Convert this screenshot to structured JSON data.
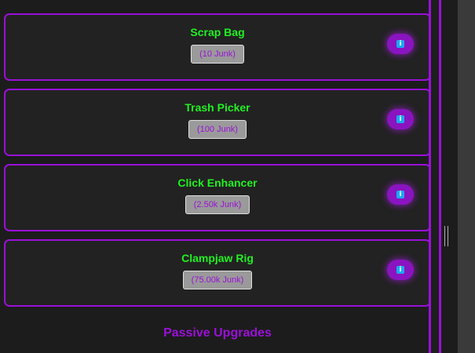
{
  "upgrades": [
    {
      "name": "Scrap Bag",
      "cost": "(10 Junk)"
    },
    {
      "name": "Trash Picker",
      "cost": "(100 Junk)"
    },
    {
      "name": "Click Enhancer",
      "cost": "(2.50k Junk)"
    },
    {
      "name": "Clampjaw Rig",
      "cost": "(75.00k Junk)"
    }
  ],
  "sections": {
    "passive_heading": "Passive Upgrades"
  },
  "icons": {
    "info": "info-icon",
    "info_glyph": "i"
  },
  "colors": {
    "accent": "#9a10d8",
    "name_text": "#22f022",
    "info_icon": "#1da8f0",
    "background": "#1c1c1c",
    "card": "#222222",
    "badge": "#9a9a9a"
  }
}
